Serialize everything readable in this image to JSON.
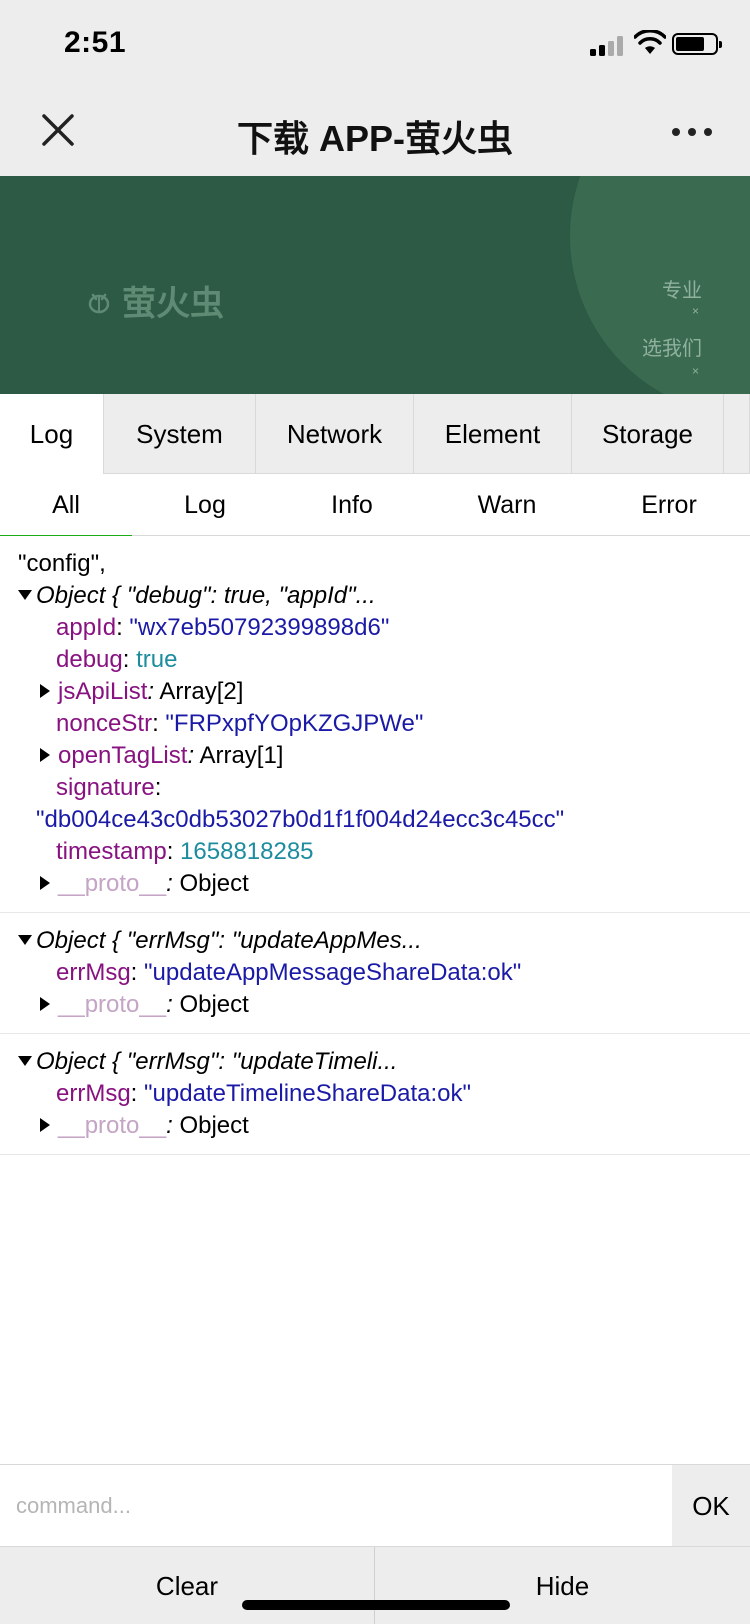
{
  "status": {
    "time": "2:51"
  },
  "window": {
    "title": "下载 APP-萤火虫"
  },
  "banner": {
    "brand": "萤火虫",
    "badge_top": "专业",
    "badge_bottom": "选我们",
    "close_mark": "×"
  },
  "tabs": [
    {
      "label": "Log",
      "active": true
    },
    {
      "label": "System"
    },
    {
      "label": "Network"
    },
    {
      "label": "Element"
    },
    {
      "label": "Storage"
    }
  ],
  "subtabs": [
    {
      "label": "All",
      "active": true
    },
    {
      "label": "Log"
    },
    {
      "label": "Info"
    },
    {
      "label": "Warn"
    },
    {
      "label": "Error"
    }
  ],
  "log": {
    "entry1": {
      "prefix": "\"config\",",
      "summary": "Object { \"debug\": true, \"appId\"...",
      "appId_key": "appId",
      "appId_val": "\"wx7eb50792399898d6\"",
      "debug_key": "debug",
      "debug_val": "true",
      "jsApiList_key": "jsApiList",
      "jsApiList_val": "Array[2]",
      "nonceStr_key": "nonceStr",
      "nonceStr_val": "\"FRPxpfYOpKZGJPWe\"",
      "openTagList_key": "openTagList",
      "openTagList_val": "Array[1]",
      "signature_key": "signature",
      "signature_val": "\"db004ce43c0db53027b0d1f1f004d24ecc3c45cc\"",
      "timestamp_key": "timestamp",
      "timestamp_val": "1658818285",
      "proto_key": "__proto__",
      "proto_val": "Object"
    },
    "entry2": {
      "summary": "Object { \"errMsg\": \"updateAppMes...",
      "errMsg_key": "errMsg",
      "errMsg_val": "\"updateAppMessageShareData:ok\"",
      "proto_key": "__proto__",
      "proto_val": "Object"
    },
    "entry3": {
      "summary": "Object { \"errMsg\": \"updateTimeli...",
      "errMsg_key": "errMsg",
      "errMsg_val": "\"updateTimelineShareData:ok\"",
      "proto_key": "__proto__",
      "proto_val": "Object"
    }
  },
  "command": {
    "placeholder": "command...",
    "ok_label": "OK"
  },
  "footer": {
    "clear_label": "Clear",
    "hide_label": "Hide"
  }
}
